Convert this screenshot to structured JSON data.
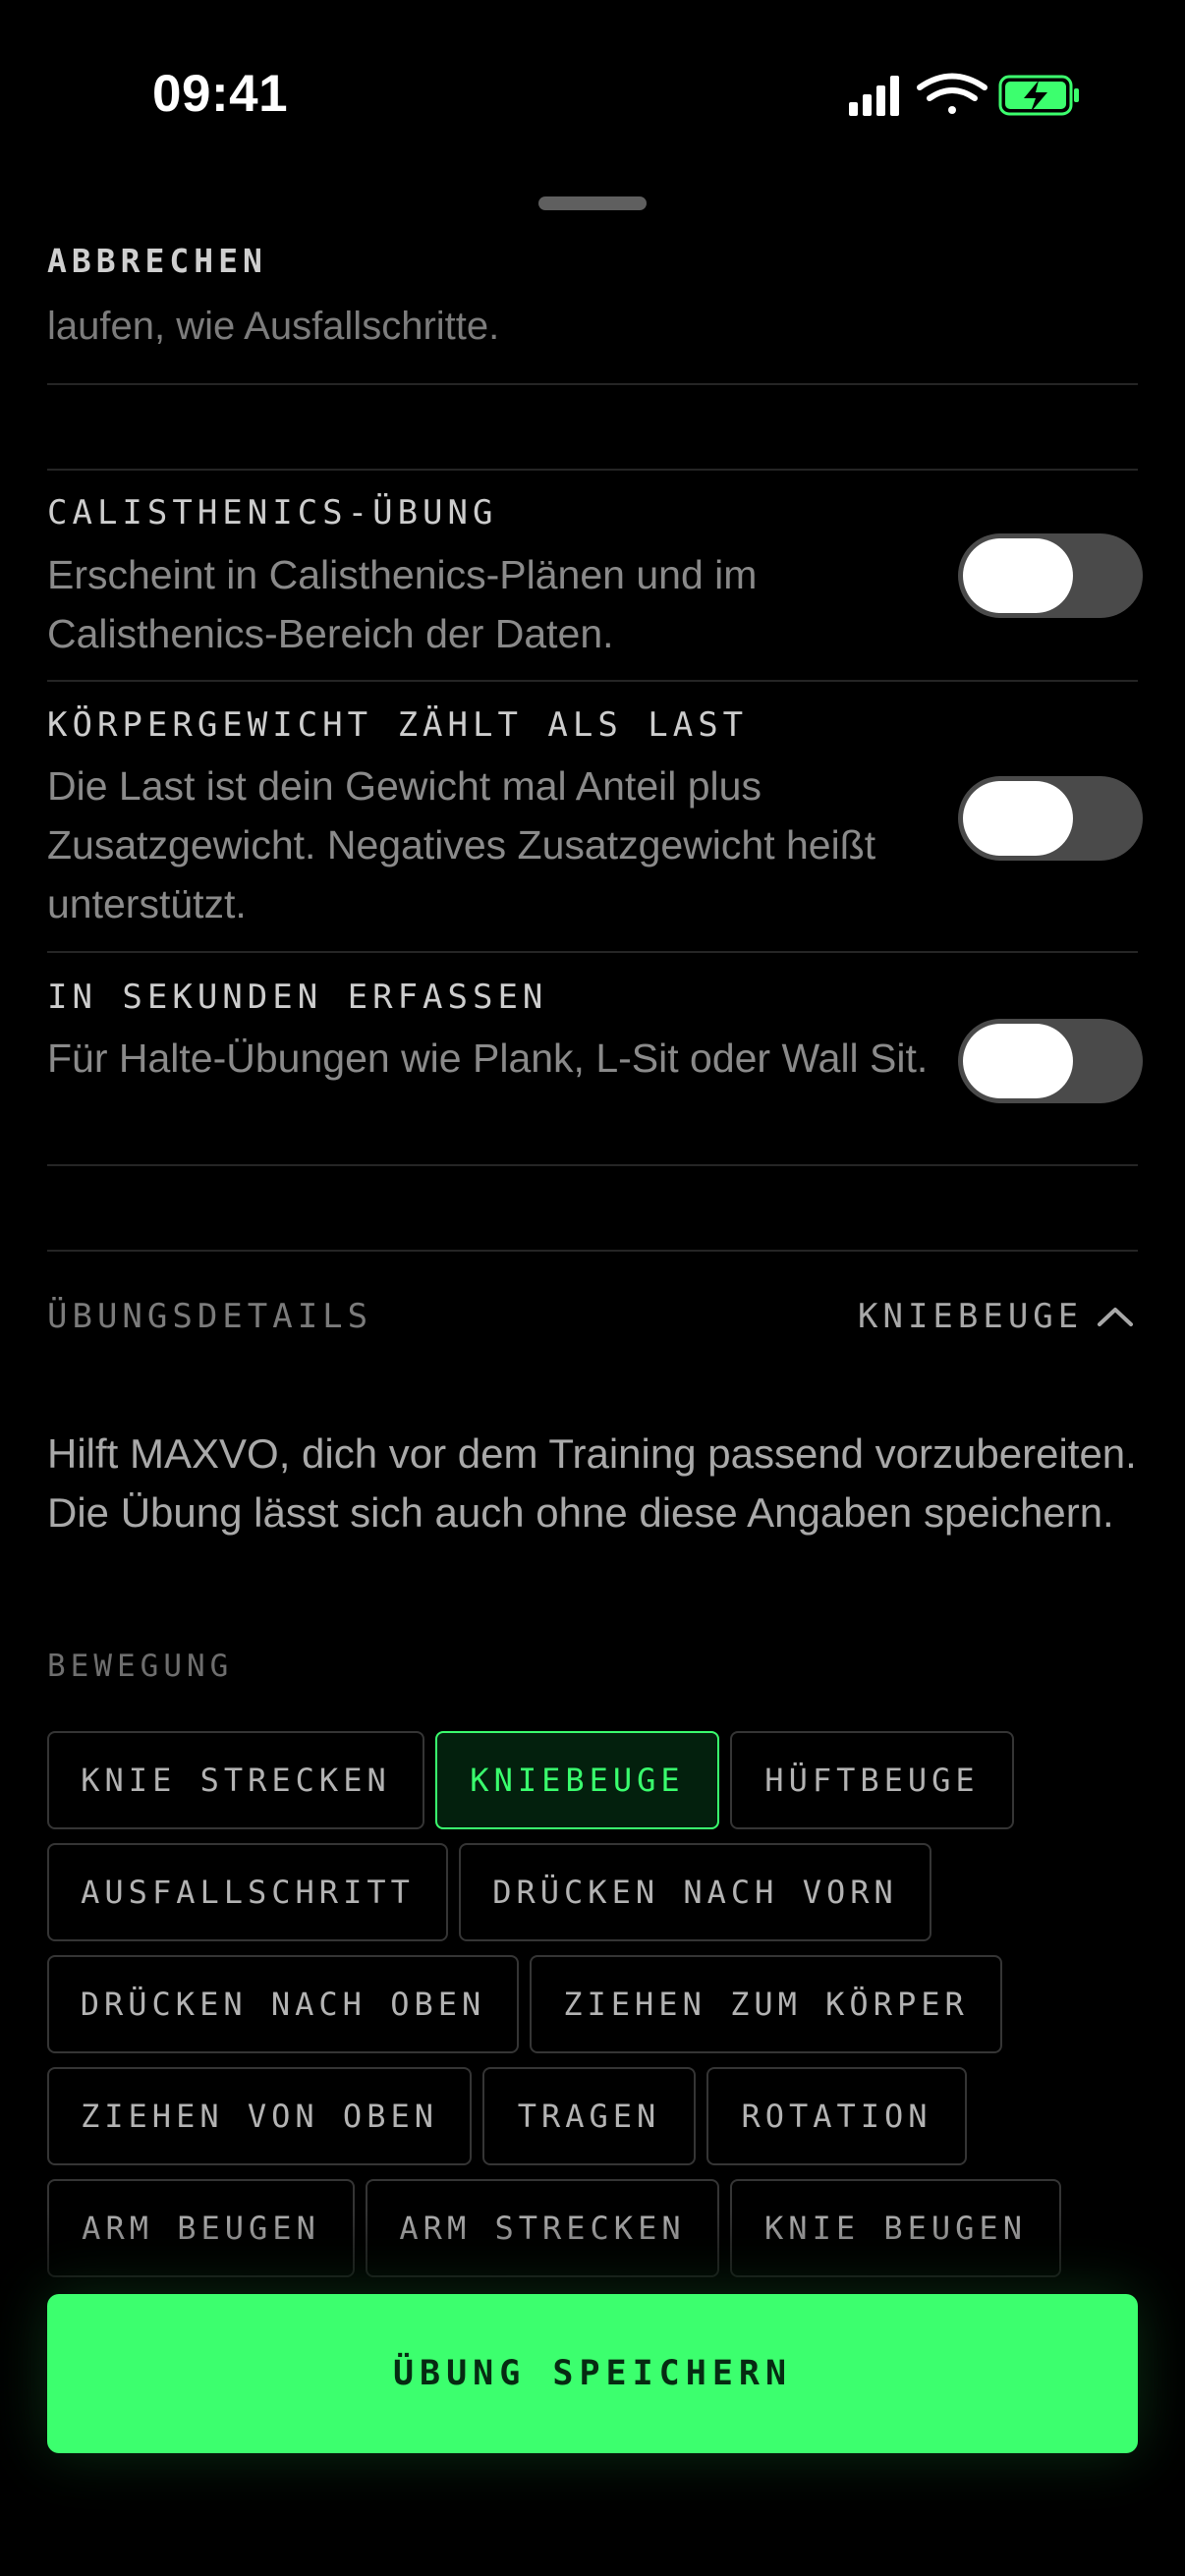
{
  "status_bar": {
    "time": "09:41",
    "icons": [
      "signal-icon",
      "wifi-icon",
      "battery-charging-icon"
    ],
    "battery_color": "#3cff6e"
  },
  "sheet": {
    "cancel_label": "ABBRECHEN",
    "cut_off_text": "laufen, wie Ausfallschritte."
  },
  "settings": [
    {
      "title": "CALISTHENICS-ÜBUNG",
      "description": "Erscheint in Calisthenics-Plänen und im Calisthenics-Bereich der Daten.",
      "enabled": false
    },
    {
      "title": "KÖRPERGEWICHT ZÄHLT ALS LAST",
      "description": "Die Last ist dein Gewicht mal Anteil plus Zusatzgewicht. Negatives Zusatzgewicht heißt unterstützt.",
      "enabled": false
    },
    {
      "title": "IN SEKUNDEN ERFASSEN",
      "description": "Für Halte-Übungen wie Plank, L-Sit oder Wall Sit.",
      "enabled": false
    }
  ],
  "details": {
    "section_label": "ÜBUNGSDETAILS",
    "section_value": "KNIEBEUGE",
    "expanded": true,
    "intro": "Hilft MAXVO, dich vor dem Training passend vorzubereiten. Die Übung lässt sich auch ohne diese Angaben speichern.",
    "movement_label": "BEWEGUNG",
    "movements": [
      "KNIE STRECKEN",
      "KNIEBEUGE",
      "HÜFTBEUGE",
      "AUSFALLSCHRITT",
      "DRÜCKEN NACH VORN",
      "DRÜCKEN NACH OBEN",
      "ZIEHEN ZUM KÖRPER",
      "ZIEHEN VON OBEN",
      "TRAGEN",
      "ROTATION",
      "ARM BEUGEN",
      "ARM STRECKEN",
      "KNIE BEUGEN"
    ],
    "selected_movement": "KNIEBEUGE"
  },
  "save_button_label": "ÜBUNG SPEICHERN",
  "accent_color": "#3cff6e"
}
